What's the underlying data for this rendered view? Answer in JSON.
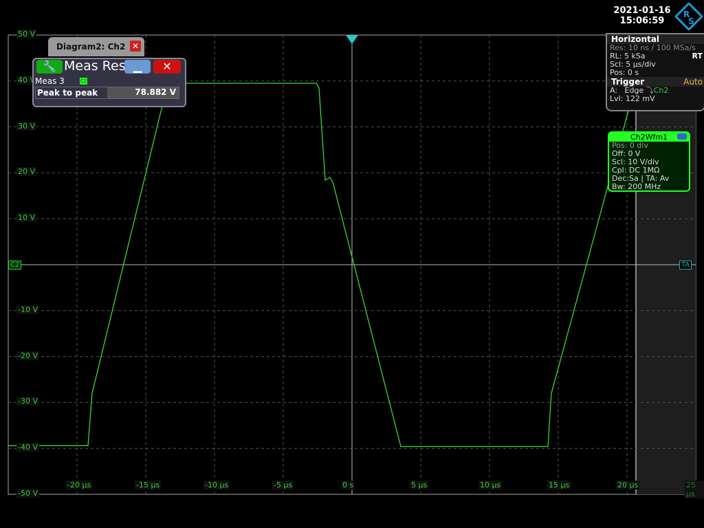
{
  "datetime": {
    "date": "2021-01-16",
    "time": "15:06:59"
  },
  "logo": "R&S",
  "horizontal": {
    "title": "Horizontal",
    "res": "Res: 10 ns / 100 MSa/s",
    "rl": "RL:  5 kSa",
    "rt": "RT",
    "scl": "Scl:  5 µs/div",
    "pos": "Pos:  0 s"
  },
  "trigger": {
    "title": "Trigger",
    "mode": "Auto",
    "type_label": "A:",
    "type": "Edge",
    "source": "Ch2",
    "lvl": "Lvl:  122 mV"
  },
  "channel": {
    "title": "Ch2Wfm1",
    "pos": "Pos: 0 div",
    "off": "Off:  0 V",
    "scl": "Scl:  10 V/div",
    "cpl": "Cpl:  DC 1MΩ",
    "dec": "Dec:Sa | TA: Av",
    "bw": "Bw:  200 MHz"
  },
  "diagram_tab": {
    "title": "Diagram2: Ch2"
  },
  "meas_result": {
    "title": "Meas Res",
    "name": "Meas 3",
    "source_badge": "C2",
    "param": "Peak to peak",
    "value": "78.882 V"
  },
  "markers": {
    "channel": "C2",
    "trigger": "TA"
  },
  "colors": {
    "trace": "#33dd33",
    "accent": "#2f2",
    "logo": "#1a9ad6",
    "trigger_mode": "#f0b040"
  },
  "chart_data": {
    "type": "line",
    "xlim": [
      -25,
      25
    ],
    "ylim": [
      -50,
      50
    ],
    "grid": true,
    "x_ticks": [
      "-20 µs",
      "-15 µs",
      "-10 µs",
      "-5 µs",
      "0 s",
      "5 µs",
      "10 µs",
      "15 µs",
      "20 µs",
      "25 µs"
    ],
    "y_ticks": [
      "50 V",
      "40 V",
      "30 V",
      "20 V",
      "10 V",
      "",
      "-10 V",
      "-20 V",
      "-30 V",
      "-40 V",
      "-50 V"
    ],
    "series": [
      {
        "x": [
          -25,
          -19.2,
          -18.9,
          -13.4,
          -2.6,
          -2.4,
          -1.95,
          -1.6,
          -1.4,
          3.55,
          14.25,
          14.5,
          20.6
        ],
        "y": [
          -39.4,
          -39.4,
          -28,
          39.5,
          39.5,
          38.5,
          18.4,
          19,
          18,
          -39.6,
          -39.6,
          -28,
          39
        ]
      }
    ]
  }
}
